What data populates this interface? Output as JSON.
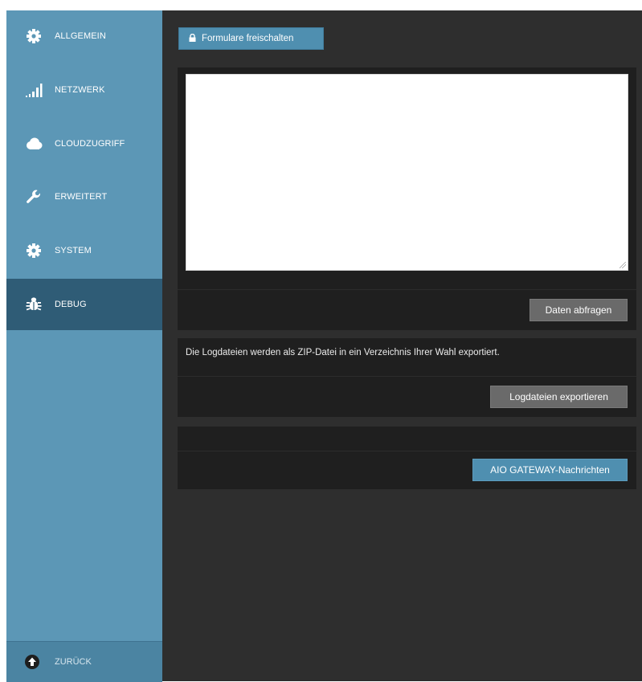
{
  "sidebar": {
    "items": [
      {
        "label": "ALLGEMEIN",
        "icon": "gear-icon"
      },
      {
        "label": "NETZWERK",
        "icon": "signal-bars-icon"
      },
      {
        "label": "CLOUDZUGRIFF",
        "icon": "cloud-icon"
      },
      {
        "label": "ERWEITERT",
        "icon": "wrench-icon"
      },
      {
        "label": "SYSTEM",
        "icon": "gear-icon"
      },
      {
        "label": "DEBUG",
        "icon": "bug-icon",
        "active": true
      }
    ],
    "back_label": "ZURÜCK",
    "back_icon": "arrow-up-circle-icon"
  },
  "main": {
    "unlock_button": "Formulare freischalten",
    "query_button": "Daten abfragen",
    "log_info": "Die Logdateien werden als ZIP-Datei in ein Verzeichnis Ihrer Wahl exportiert.",
    "export_button": "Logdateien exportieren",
    "gateway_button": "AIO GATEWAY-Nachrichten"
  },
  "colors": {
    "sidebar": "#5c97b6",
    "sidebar_active": "#2f5c76",
    "main_bg": "#2e2e2e",
    "panel_bg": "#1f1f1f",
    "accent": "#4f8fb0",
    "button_gray": "#6a6a6a"
  }
}
